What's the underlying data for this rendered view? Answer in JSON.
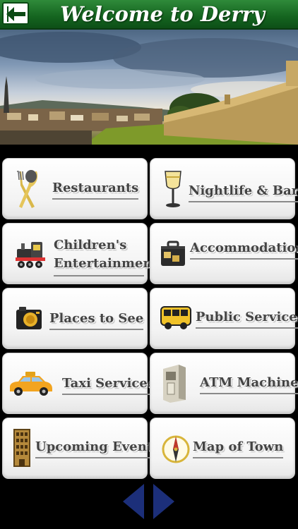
{
  "header": {
    "title": "Welcome to Derry",
    "back_icon": "back-arrow-icon"
  },
  "hero": {
    "image": "derry-city-walls-photo"
  },
  "menu": [
    {
      "label": "Restaurants",
      "icon": "cutlery-icon"
    },
    {
      "label": "Nightlife & Bars",
      "icon": "wine-glass-icon"
    },
    {
      "label": "Children's Entertainment",
      "icon": "toy-train-icon"
    },
    {
      "label": "Accommodation",
      "icon": "suitcase-icon"
    },
    {
      "label": "Places to See",
      "icon": "camera-icon"
    },
    {
      "label": "Public Services",
      "icon": "bus-icon"
    },
    {
      "label": "Taxi Services",
      "icon": "taxi-icon"
    },
    {
      "label": "ATM Machines",
      "icon": "atm-icon"
    },
    {
      "label": "Upcoming Events",
      "icon": "building-icon"
    },
    {
      "label": "Map of Town",
      "icon": "compass-icon"
    }
  ],
  "nav": {
    "prev_icon": "previous-arrow-icon",
    "next_icon": "next-arrow-icon"
  },
  "colors": {
    "header_green": "#14641f",
    "nav_blue": "#1c2f7a",
    "label_text": "#444444"
  }
}
